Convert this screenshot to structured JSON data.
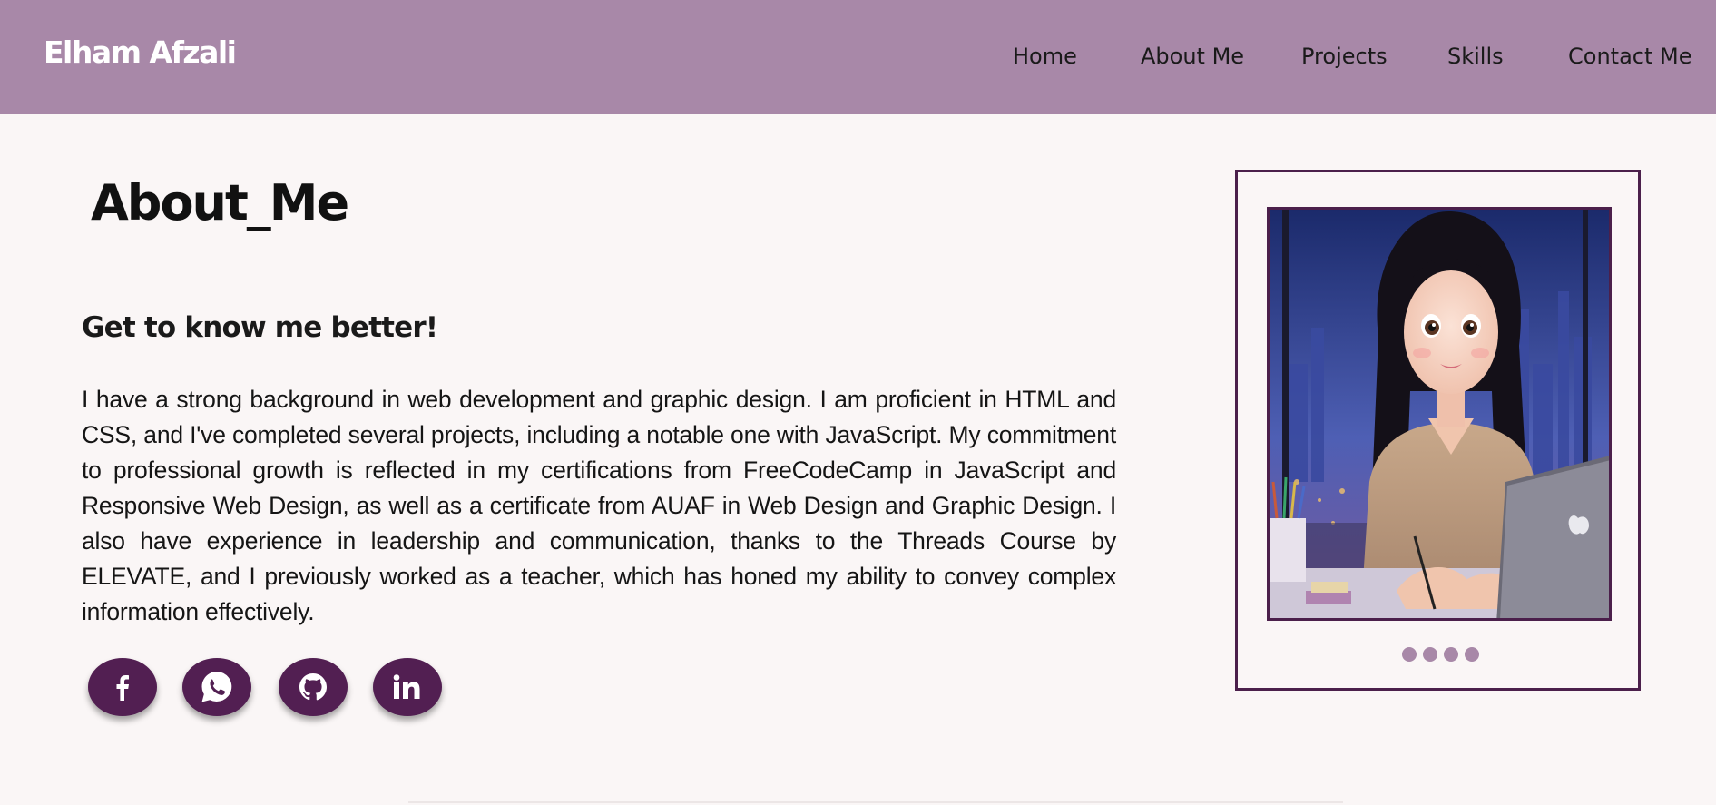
{
  "brand": "Elham Afzali",
  "nav": {
    "home": "Home",
    "about": "About Me",
    "projects": "Projects",
    "skills": "Skills",
    "contact": "Contact Me"
  },
  "main": {
    "title": "About_Me",
    "subtitle": "Get to know me better!",
    "bio": "I have a strong background in web development and graphic design. I am proficient in HTML and CSS, and I've completed several projects, including a notable one with JavaScript. My commitment to professional growth is reflected in my certifications from FreeCodeCamp in JavaScript and Responsive Web Design, as well as a certificate from AUAF in Web Design and Graphic Design. I also have experience in leadership and communication, thanks to the Threads Course by ELEVATE, and I previously worked as a teacher, which has honed my ability to convey complex information effectively."
  },
  "social": [
    {
      "icon": "facebook-icon"
    },
    {
      "icon": "whatsapp-icon"
    },
    {
      "icon": "github-icon"
    },
    {
      "icon": "linkedin-icon"
    }
  ],
  "carousel": {
    "slides": 4
  },
  "colors": {
    "navbar": "#a888a8",
    "accent": "#521f52",
    "background": "#faf6f6",
    "dot": "#a888a8"
  }
}
